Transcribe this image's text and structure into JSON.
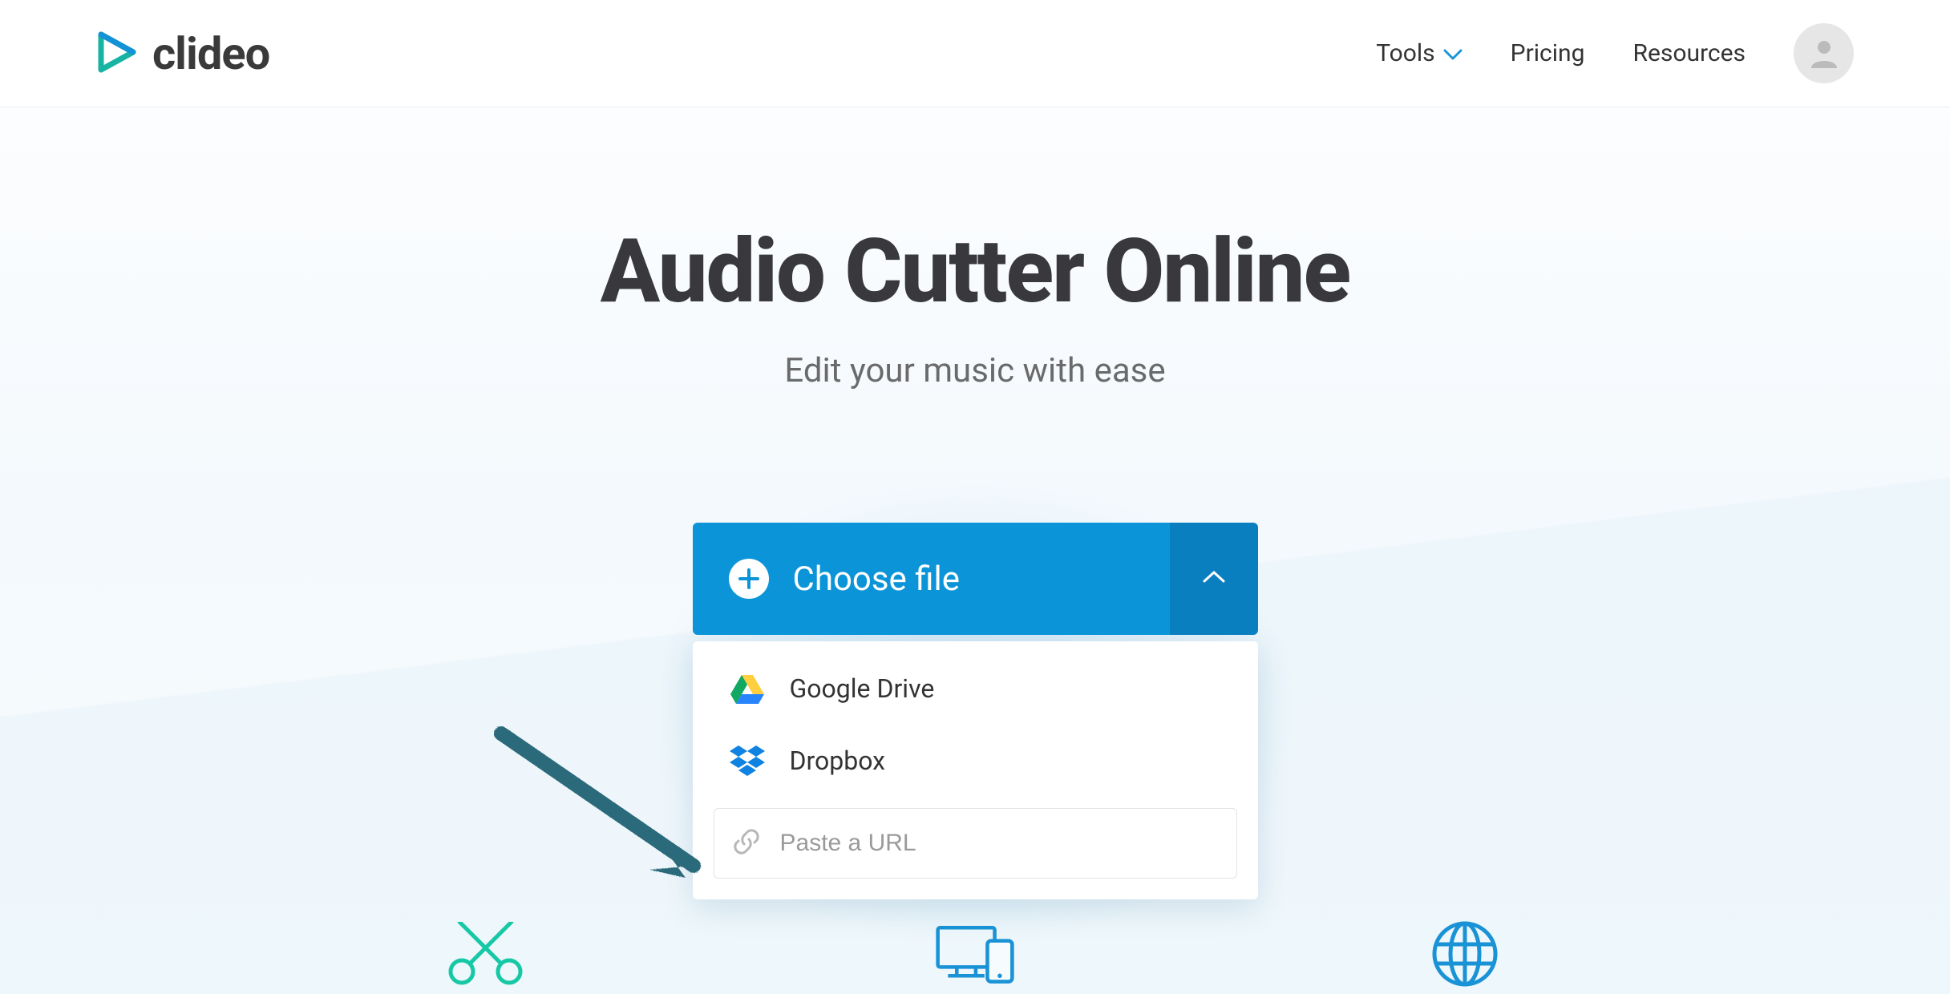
{
  "brand": "clideo",
  "nav": {
    "tools": "Tools",
    "pricing": "Pricing",
    "resources": "Resources"
  },
  "hero": {
    "title": "Audio Cutter Online",
    "subtitle": "Edit your music with ease"
  },
  "uploader": {
    "choose_label": "Choose file",
    "options": {
      "gdrive": "Google Drive",
      "dropbox": "Dropbox"
    },
    "url_placeholder": "Paste a URL"
  }
}
